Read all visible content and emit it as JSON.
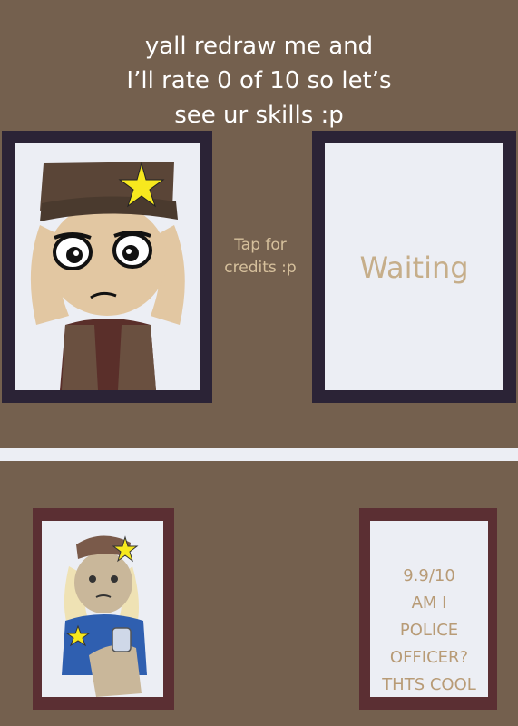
{
  "title": {
    "line1": "yall redraw me and",
    "line2": "I’ll rate 0 of 10 so let’s",
    "line3": "see ur skills :p"
  },
  "credits": {
    "line1": "Tap for",
    "line2": "credits :p"
  },
  "waiting_label": "Waiting",
  "rating": {
    "line1": "9.9/10",
    "line2": "AM I",
    "line3": "POLICE",
    "line4": "OFFICER?",
    "line5": "THTS COOL"
  },
  "colors": {
    "background": "#74604e",
    "dark_frame": "#2b2336",
    "red_frame": "#5b2f33",
    "canvas": "#eceef4",
    "accent_text": "#d6c09c",
    "star": "#f7e81e"
  }
}
